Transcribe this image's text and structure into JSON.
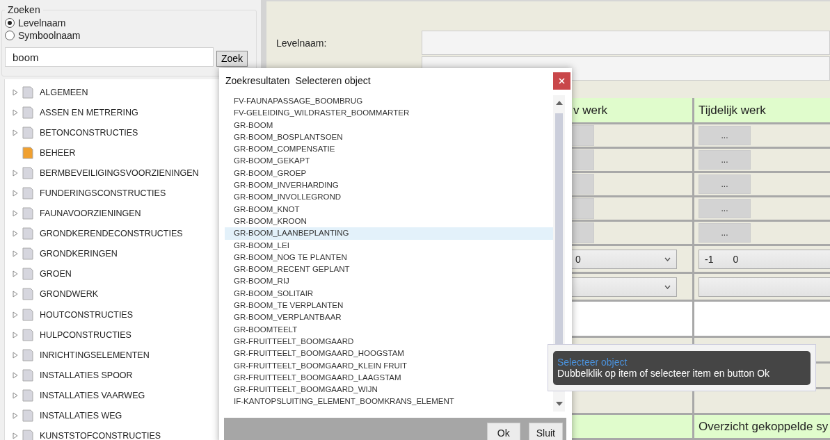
{
  "search": {
    "title": "Zoeken",
    "options": [
      {
        "label": "Levelnaam",
        "selected": true
      },
      {
        "label": "Symboolnaam",
        "selected": false
      }
    ],
    "value": "boom",
    "button": "Zoek"
  },
  "tree": [
    {
      "label": "ALGEMEEN",
      "expandable": true,
      "color": "#d6d6de"
    },
    {
      "label": "ASSEN EN METRERING",
      "expandable": true,
      "color": "#d6d6de"
    },
    {
      "label": "BETONCONSTRUCTIES",
      "expandable": true,
      "color": "#d6d6de"
    },
    {
      "label": "BEHEER",
      "expandable": false,
      "color": "#f0a030"
    },
    {
      "label": "BERMBEVEILIGINGSVOORZIENINGEN",
      "expandable": true,
      "color": "#d6d6de"
    },
    {
      "label": "FUNDERINGSCONSTRUCTIES",
      "expandable": true,
      "color": "#d6d6de"
    },
    {
      "label": "FAUNAVOORZIENINGEN",
      "expandable": true,
      "color": "#d6d6de"
    },
    {
      "label": "GRONDKERENDECONSTRUCTIES",
      "expandable": true,
      "color": "#d6d6de"
    },
    {
      "label": "GRONDKERINGEN",
      "expandable": true,
      "color": "#d6d6de"
    },
    {
      "label": "GROEN",
      "expandable": true,
      "color": "#d6d6de"
    },
    {
      "label": "GRONDWERK",
      "expandable": true,
      "color": "#d6d6de"
    },
    {
      "label": "HOUTCONSTRUCTIES",
      "expandable": true,
      "color": "#d6d6de"
    },
    {
      "label": "HULPCONSTRUCTIES",
      "expandable": true,
      "color": "#d6d6de"
    },
    {
      "label": "INRICHTINGSELEMENTEN",
      "expandable": true,
      "color": "#d6d6de"
    },
    {
      "label": "INSTALLATIES SPOOR",
      "expandable": true,
      "color": "#d6d6de"
    },
    {
      "label": "INSTALLATIES VAARWEG",
      "expandable": true,
      "color": "#d6d6de"
    },
    {
      "label": "INSTALLATIES WEG",
      "expandable": true,
      "color": "#d6d6de"
    },
    {
      "label": "KUNSTSTOFCONSTRUCTIES",
      "expandable": true,
      "color": "#d6d6de"
    }
  ],
  "details": {
    "level_label": "Levelnaam:",
    "headers": [
      "v werk",
      "Tijdelijk werk"
    ],
    "rows": [
      {
        "kind": "buttons",
        "tijdelijk": "..."
      },
      {
        "kind": "buttons",
        "tijdelijk": "..."
      },
      {
        "kind": "buttons",
        "tijdelijk": "..."
      },
      {
        "kind": "buttons",
        "tijdelijk": "..."
      },
      {
        "kind": "buttons",
        "tijdelijk": "..."
      },
      {
        "kind": "dropdown",
        "nieuw": [
          "0"
        ],
        "tijdelijk": [
          "-1",
          "0"
        ]
      },
      {
        "kind": "dropdown"
      },
      {
        "kind": "blank"
      },
      {
        "kind": "empty"
      },
      {
        "kind": "empty"
      },
      {
        "kind": "empty"
      },
      {
        "kind": "header",
        "tijdelijk": "Overzicht gekoppelde sy"
      }
    ]
  },
  "dialog": {
    "title": "Zoekresultaten  Selecteren object",
    "items": [
      {
        "label": "FV-FAUNAPASSAGE_BOOMBRUG",
        "selected": false
      },
      {
        "label": "FV-GELEIDING_WILDRASTER_BOOMMARTER",
        "selected": false
      },
      {
        "label": "GR-BOOM",
        "selected": false
      },
      {
        "label": "GR-BOOM_BOSPLANTSOEN",
        "selected": false
      },
      {
        "label": "GR-BOOM_COMPENSATIE",
        "selected": false
      },
      {
        "label": "GR-BOOM_GEKAPT",
        "selected": false
      },
      {
        "label": "GR-BOOM_GROEP",
        "selected": false
      },
      {
        "label": "GR-BOOM_INVERHARDING",
        "selected": false
      },
      {
        "label": "GR-BOOM_INVOLLEGROND",
        "selected": false
      },
      {
        "label": "GR-BOOM_KNOT",
        "selected": false
      },
      {
        "label": "GR-BOOM_KROON",
        "selected": false
      },
      {
        "label": "GR-BOOM_LAANBEPLANTING",
        "selected": true
      },
      {
        "label": "GR-BOOM_LEI",
        "selected": false
      },
      {
        "label": "GR-BOOM_NOG TE PLANTEN",
        "selected": false
      },
      {
        "label": "GR-BOOM_RECENT GEPLANT",
        "selected": false
      },
      {
        "label": "GR-BOOM_RIJ",
        "selected": false
      },
      {
        "label": "GR-BOOM_SOLITAIR",
        "selected": false
      },
      {
        "label": "GR-BOOM_TE VERPLANTEN",
        "selected": false
      },
      {
        "label": "GR-BOOM_VERPLANTBAAR",
        "selected": false
      },
      {
        "label": "GR-BOOMTEELT",
        "selected": false
      },
      {
        "label": "GR-FRUITTEELT_BOOMGAARD",
        "selected": false
      },
      {
        "label": "GR-FRUITTEELT_BOOMGAARD_HOOGSTAM",
        "selected": false
      },
      {
        "label": "GR-FRUITTEELT_BOOMGAARD_KLEIN FRUIT",
        "selected": false
      },
      {
        "label": "GR-FRUITTEELT_BOOMGAARD_LAAGSTAM",
        "selected": false
      },
      {
        "label": "GR-FRUITTEELT_BOOMGAARD_WIJN",
        "selected": false
      },
      {
        "label": "IF-KANTOPSLUITING_ELEMENT_BOOMKRANS_ELEMENT",
        "selected": false
      }
    ],
    "buttons": [
      "Ok",
      "Sluit"
    ]
  },
  "tooltip": {
    "title": "Selecteer object",
    "text": "Dubbelklik op item of selecteer item en button Ok"
  }
}
